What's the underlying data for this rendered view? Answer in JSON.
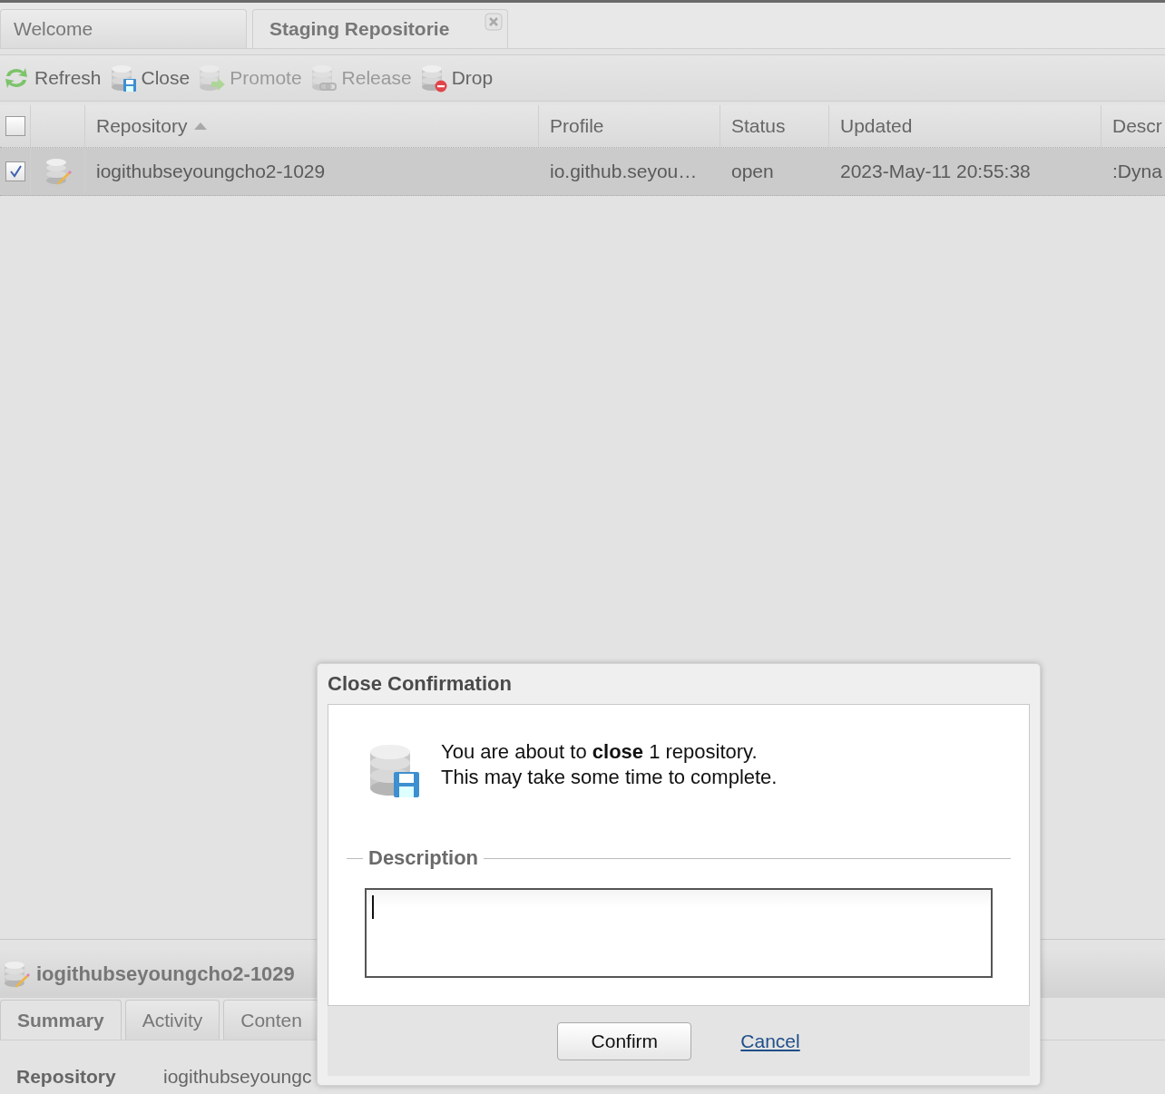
{
  "tabs": [
    {
      "label": "Welcome",
      "selected": false,
      "closable": false
    },
    {
      "label": "Staging Repositorie",
      "selected": true,
      "closable": true
    }
  ],
  "toolbar": [
    {
      "label": "Refresh",
      "kind": "refresh",
      "disabled": false
    },
    {
      "label": "Close",
      "kind": "close",
      "disabled": false
    },
    {
      "label": "Promote",
      "kind": "promote",
      "disabled": true
    },
    {
      "label": "Release",
      "kind": "release",
      "disabled": true
    },
    {
      "label": "Drop",
      "kind": "drop",
      "disabled": false
    }
  ],
  "grid": {
    "all_checked": false,
    "columns": [
      {
        "label": "Repository",
        "sorted": true
      },
      {
        "label": "Profile",
        "sorted": false
      },
      {
        "label": "Status",
        "sorted": false
      },
      {
        "label": "Updated",
        "sorted": false
      },
      {
        "label": "Descr",
        "sorted": false
      }
    ],
    "rows": [
      {
        "checked": true,
        "selected": true,
        "cells": [
          "iogithubseyoungcho2-1029",
          "io.github.seyou…",
          "open",
          "2023-May-11 20:55:38",
          ":Dyna"
        ]
      }
    ]
  },
  "detail_panel": {
    "title": "iogithubseyoungcho2-1029",
    "tabs": [
      {
        "label": "Summary",
        "selected": true
      },
      {
        "label": "Activity",
        "selected": false
      },
      {
        "label": "Conten",
        "selected": false
      }
    ],
    "fields": [
      {
        "label": "Repository",
        "value": "iogithubseyoungc"
      }
    ]
  },
  "dialog": {
    "title": "Close Confirmation",
    "message": [
      "You are about to **close** 1 repository.",
      "This may take some time to complete."
    ],
    "description": {
      "legend": "Description"
    },
    "buttons": [
      {
        "label": "Confirm",
        "kind": "button"
      },
      {
        "label": "Cancel",
        "kind": "link"
      }
    ]
  }
}
